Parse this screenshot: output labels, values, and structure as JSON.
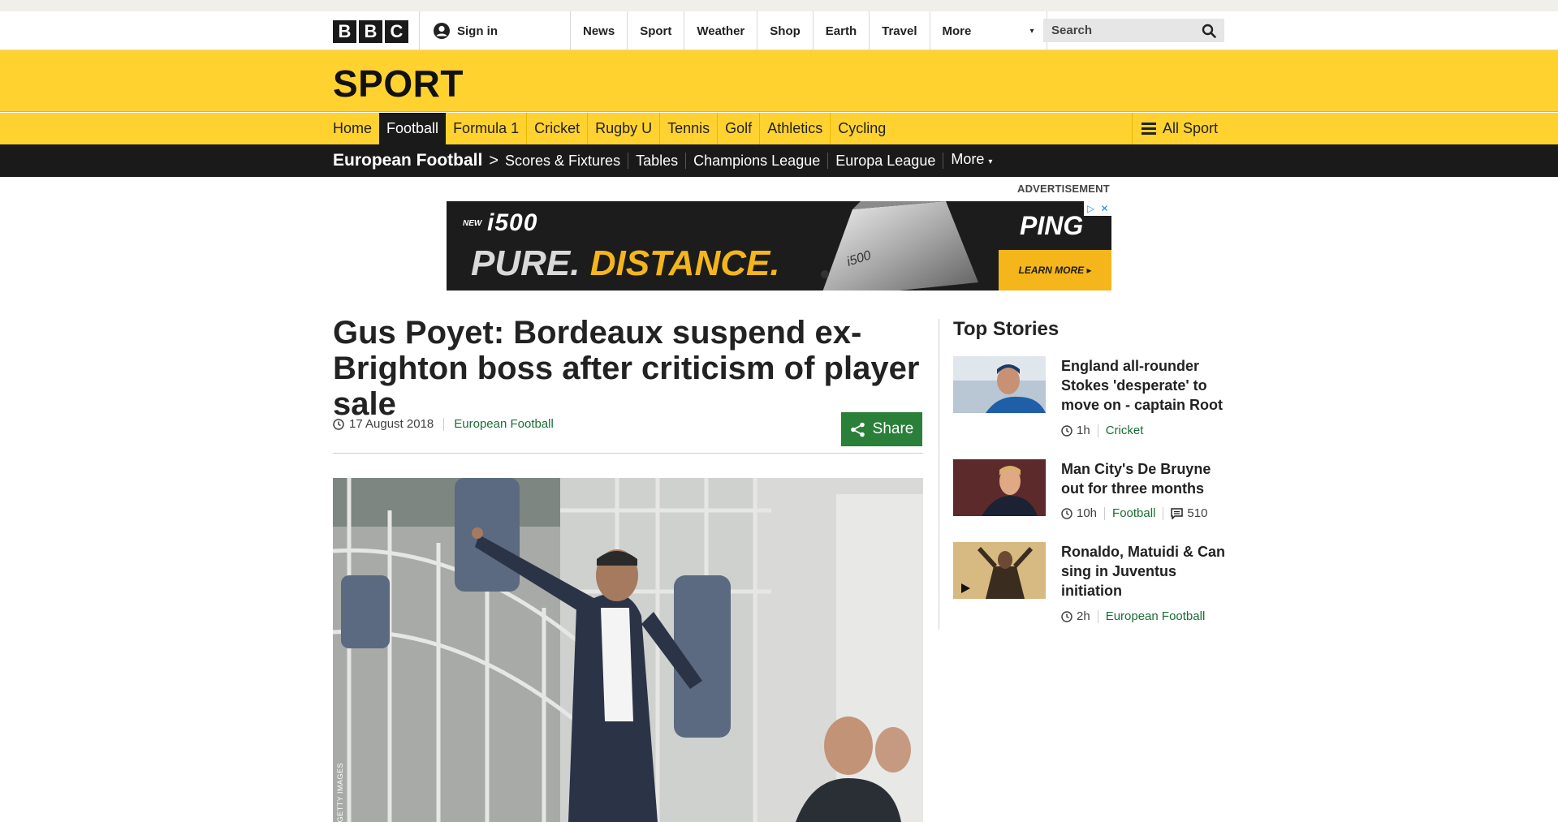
{
  "bbc_logo": [
    "B",
    "B",
    "C"
  ],
  "masthead": {
    "signin_label": "Sign in",
    "nav": [
      "News",
      "Sport",
      "Weather",
      "Shop",
      "Earth",
      "Travel"
    ],
    "more_label": "More",
    "search_placeholder": "Search"
  },
  "sport": {
    "title": "SPORT",
    "nav": [
      "Home",
      "Football",
      "Formula 1",
      "Cricket",
      "Rugby U",
      "Tennis",
      "Golf",
      "Athletics",
      "Cycling"
    ],
    "active": "Football",
    "all_sport_label": "All Sport"
  },
  "subnav": {
    "section_title": "European Football",
    "items": [
      "Scores & Fixtures",
      "Tables",
      "Champions League",
      "Europa League",
      "More"
    ]
  },
  "ad": {
    "label": "ADVERTISEMENT",
    "new_tag": "NEW",
    "product": "i500",
    "pure": "PURE.",
    "distance": "DISTANCE.",
    "club_text": "i500",
    "brand": "PING",
    "cta": "LEARN MORE ▸"
  },
  "article": {
    "headline": "Gus Poyet: Bordeaux suspend ex-Brighton boss after criticism of player sale",
    "date": "17 August 2018",
    "section": "European Football",
    "share_label": "Share",
    "image_credit": "GETTY IMAGES"
  },
  "top_stories": {
    "title": "Top Stories",
    "items": [
      {
        "headline": "England all-rounder Stokes 'desperate' to move on - captain Root",
        "time": "1h",
        "section": "Cricket",
        "comments": null
      },
      {
        "headline": "Man City's De Bruyne out for three months",
        "time": "10h",
        "section": "Football",
        "comments": "510"
      },
      {
        "headline": "Ronaldo, Matuidi & Can sing in Juventus initiation",
        "time": "2h",
        "section": "European Football",
        "comments": null
      }
    ]
  },
  "colors": {
    "sport_yellow": "#ffd230",
    "dark": "#1a1a1a",
    "link_green": "#1a6e35",
    "share_green": "#2a7f39",
    "ad_orange": "#f5b61b"
  }
}
